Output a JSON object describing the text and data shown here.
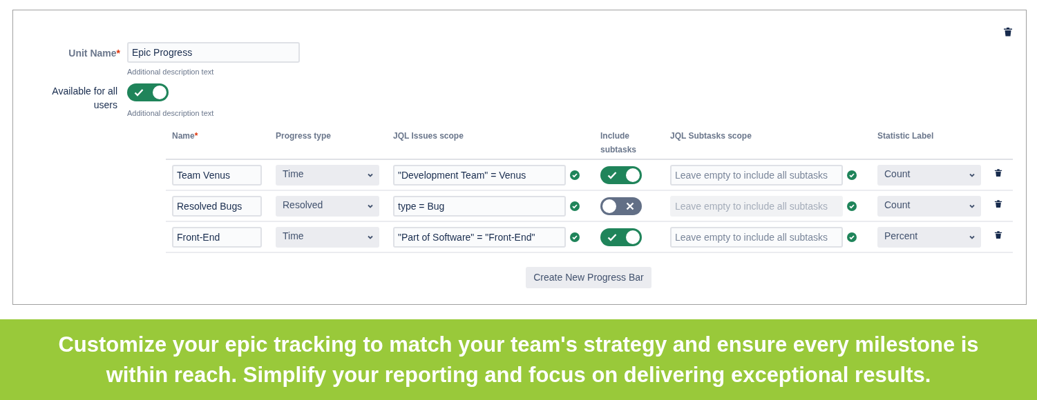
{
  "unit_name": {
    "label": "Unit Name",
    "required_mark": "*",
    "value": "Epic Progress",
    "description": "Additional description text"
  },
  "available": {
    "label": "Available for all users",
    "on": true,
    "description": "Additional description text"
  },
  "columns": [
    {
      "label": "Name",
      "required_mark": "*"
    },
    {
      "label": "Progress type"
    },
    {
      "label": "JQL Issues scope"
    },
    {
      "label": "Include subtasks"
    },
    {
      "label": "JQL Subtasks scope"
    },
    {
      "label": "Statistic Label"
    }
  ],
  "rows": [
    {
      "name": "Team Venus",
      "progress_type": "Time",
      "jql": "\"Development Team\" = Venus",
      "jql_valid": true,
      "include_subtasks": true,
      "subtasks_placeholder": "Leave empty to include all subtasks",
      "subtasks_valid": true,
      "statistic": "Count"
    },
    {
      "name": "Resolved Bugs",
      "progress_type": "Resolved",
      "jql": "type = Bug",
      "jql_valid": true,
      "include_subtasks": false,
      "subtasks_placeholder": "Leave empty to include all subtasks",
      "subtasks_valid": true,
      "statistic": "Count"
    },
    {
      "name": "Front-End",
      "progress_type": "Time",
      "jql": "\"Part of Software\" = \"Front-End\"",
      "jql_valid": true,
      "include_subtasks": true,
      "subtasks_placeholder": "Leave empty to include all subtasks",
      "subtasks_valid": true,
      "statistic": "Percent"
    }
  ],
  "create_button": "Create New Progress Bar",
  "banner": "Customize your epic tracking to match your team's strategy and ensure every milestone is\nwithin reach. Simplify your reporting and focus on delivering exceptional results."
}
